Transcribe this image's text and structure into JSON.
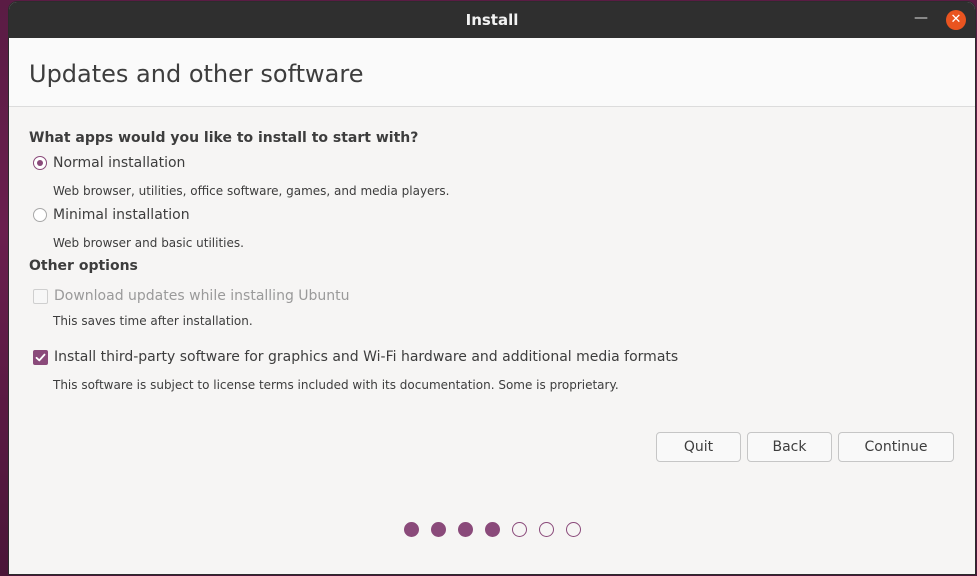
{
  "window": {
    "title": "Install",
    "minimize_label": "—",
    "close_label": "✕"
  },
  "page": {
    "title": "Updates and other software"
  },
  "apps_section": {
    "heading": "What apps would you like to install to start with?",
    "options": [
      {
        "label": "Normal installation",
        "description": "Web browser, utilities, office software, games, and media players.",
        "selected": true
      },
      {
        "label": "Minimal installation",
        "description": "Web browser and basic utilities.",
        "selected": false
      }
    ]
  },
  "other_section": {
    "heading": "Other options",
    "options": [
      {
        "label": "Download updates while installing Ubuntu",
        "description": "This saves time after installation.",
        "checked": false,
        "disabled": true
      },
      {
        "label": "Install third-party software for graphics and Wi-Fi hardware and additional media formats",
        "description": "This software is subject to license terms included with its documentation. Some is proprietary.",
        "checked": true,
        "disabled": false
      }
    ]
  },
  "buttons": {
    "quit": "Quit",
    "back": "Back",
    "continue": "Continue"
  },
  "progress": {
    "total_steps": 7,
    "completed_steps": 4
  },
  "colors": {
    "accent": "#8a4a7a",
    "close_button": "#e95420",
    "titlebar": "#2f2f2f"
  },
  "icons": {
    "checkmark": "checkmark-icon",
    "close": "close-icon",
    "minimize": "minimize-icon"
  }
}
